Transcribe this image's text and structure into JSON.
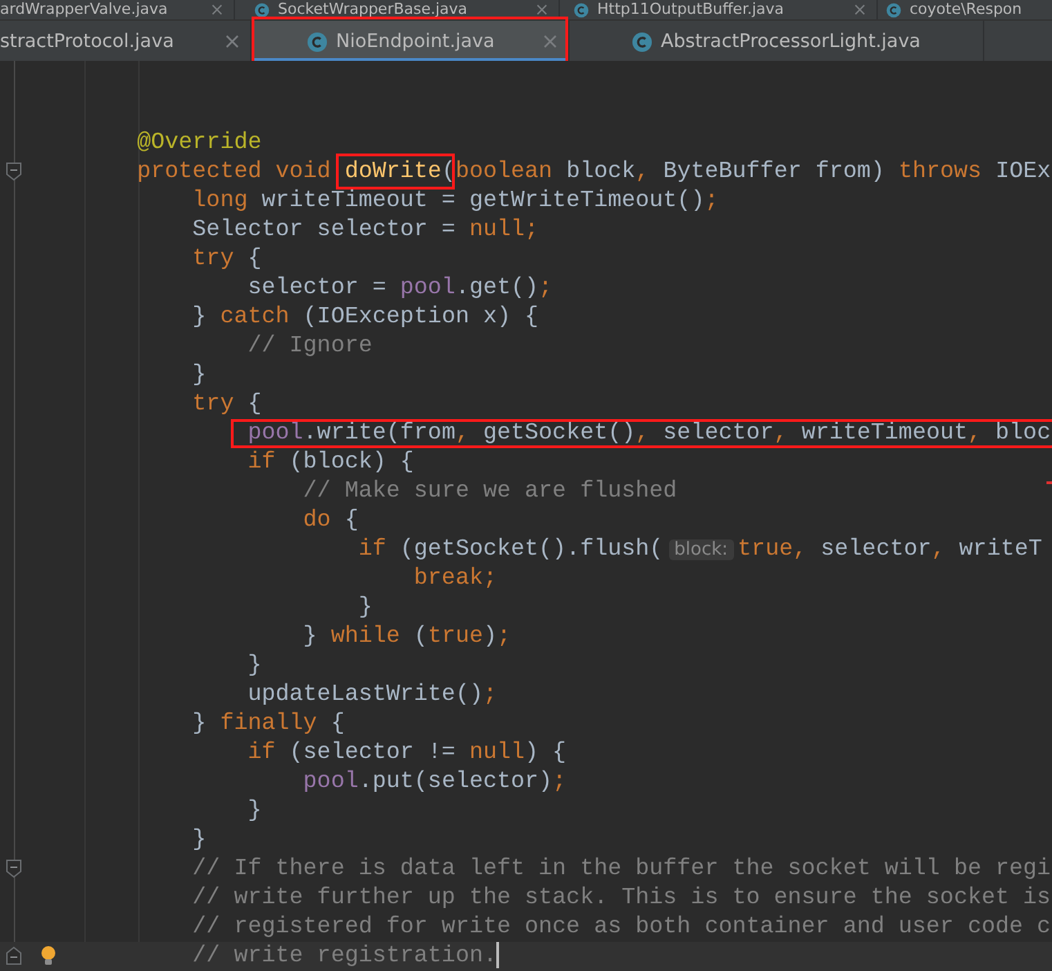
{
  "tab_rows": [
    {
      "tabs": [
        {
          "label": "ardWrapperValve.java",
          "icon": false,
          "closable": true,
          "selected": false,
          "boxed": false
        },
        {
          "label": "SocketWrapperBase.java",
          "icon": true,
          "closable": true,
          "selected": false,
          "boxed": false
        },
        {
          "label": "Http11OutputBuffer.java",
          "icon": true,
          "closable": true,
          "selected": false,
          "boxed": false
        },
        {
          "label": "coyote\\Respon",
          "icon": true,
          "closable": false,
          "selected": false,
          "boxed": false
        }
      ]
    },
    {
      "tabs": [
        {
          "label": "stractProtocol.java",
          "icon": false,
          "closable": true,
          "selected": false,
          "boxed": false
        },
        {
          "label": "NioEndpoint.java",
          "icon": true,
          "closable": true,
          "selected": true,
          "boxed": true
        },
        {
          "label": "AbstractProcessorLight.java",
          "icon": true,
          "closable": false,
          "selected": false,
          "boxed": false
        }
      ]
    }
  ],
  "editor": {
    "lines": [
      {
        "tokens": [
          {
            "kind": "annotation",
            "text": "        @Override"
          }
        ]
      },
      {
        "fold_start": true,
        "tokens": [
          {
            "kind": "keyword",
            "text": "        protected void "
          },
          {
            "kind": "declaration",
            "text": "doWrite",
            "boxed": true
          },
          {
            "kind": "plain",
            "text": "("
          },
          {
            "kind": "keyword",
            "text": "boolean "
          },
          {
            "kind": "plain",
            "text": "block"
          },
          {
            "kind": "punct",
            "text": ", "
          },
          {
            "kind": "plain",
            "text": "ByteBuffer from) "
          },
          {
            "kind": "keyword",
            "text": "throws "
          },
          {
            "kind": "plain",
            "text": "IOEx"
          }
        ]
      },
      {
        "tokens": [
          {
            "kind": "keyword",
            "text": "            long "
          },
          {
            "kind": "plain",
            "text": "writeTimeout = getWriteTimeout()"
          },
          {
            "kind": "punct",
            "text": ";"
          }
        ]
      },
      {
        "tokens": [
          {
            "kind": "plain",
            "text": "            Selector selector = "
          },
          {
            "kind": "keyword",
            "text": "null"
          },
          {
            "kind": "punct",
            "text": ";"
          }
        ]
      },
      {
        "tokens": [
          {
            "kind": "keyword",
            "text": "            try "
          },
          {
            "kind": "plain",
            "text": "{"
          }
        ]
      },
      {
        "tokens": [
          {
            "kind": "plain",
            "text": "                selector = "
          },
          {
            "kind": "field",
            "text": "pool"
          },
          {
            "kind": "plain",
            "text": ".get()"
          },
          {
            "kind": "punct",
            "text": ";"
          }
        ]
      },
      {
        "tokens": [
          {
            "kind": "plain",
            "text": "            } "
          },
          {
            "kind": "keyword",
            "text": "catch "
          },
          {
            "kind": "plain",
            "text": "(IOException x) {"
          }
        ]
      },
      {
        "tokens": [
          {
            "kind": "comment",
            "text": "                // Ignore"
          }
        ]
      },
      {
        "tokens": [
          {
            "kind": "plain",
            "text": "            }"
          }
        ]
      },
      {
        "tokens": [
          {
            "kind": "keyword",
            "text": "            try "
          },
          {
            "kind": "plain",
            "text": "{"
          }
        ]
      },
      {
        "boxed": true,
        "tokens": [
          {
            "kind": "field",
            "text": "                pool"
          },
          {
            "kind": "plain",
            "text": ".write(from"
          },
          {
            "kind": "punct",
            "text": ", "
          },
          {
            "kind": "plain",
            "text": "getSocket()"
          },
          {
            "kind": "punct",
            "text": ", "
          },
          {
            "kind": "plain",
            "text": "selector"
          },
          {
            "kind": "punct",
            "text": ", "
          },
          {
            "kind": "plain",
            "text": "writeTimeout"
          },
          {
            "kind": "punct",
            "text": ", "
          },
          {
            "kind": "plain",
            "text": "bloc"
          }
        ]
      },
      {
        "tokens": [
          {
            "kind": "keyword",
            "text": "                if "
          },
          {
            "kind": "plain",
            "text": "(block) {"
          }
        ]
      },
      {
        "tokens": [
          {
            "kind": "comment",
            "text": "                    // Make sure we are flushed"
          }
        ]
      },
      {
        "tokens": [
          {
            "kind": "keyword",
            "text": "                    do "
          },
          {
            "kind": "plain",
            "text": "{"
          }
        ]
      },
      {
        "tokens": [
          {
            "kind": "keyword",
            "text": "                        if "
          },
          {
            "kind": "plain",
            "text": "(getSocket().flush("
          },
          {
            "kind": "hint",
            "text": "block:"
          },
          {
            "kind": "keyword",
            "text": "true"
          },
          {
            "kind": "punct",
            "text": ", "
          },
          {
            "kind": "plain",
            "text": "selector"
          },
          {
            "kind": "punct",
            "text": ", "
          },
          {
            "kind": "plain",
            "text": "writeT"
          }
        ]
      },
      {
        "tokens": [
          {
            "kind": "keyword",
            "text": "                            break"
          },
          {
            "kind": "punct",
            "text": ";"
          }
        ]
      },
      {
        "tokens": [
          {
            "kind": "plain",
            "text": "                        }"
          }
        ]
      },
      {
        "tokens": [
          {
            "kind": "plain",
            "text": "                    } "
          },
          {
            "kind": "keyword",
            "text": "while "
          },
          {
            "kind": "plain",
            "text": "("
          },
          {
            "kind": "keyword",
            "text": "true"
          },
          {
            "kind": "plain",
            "text": ")"
          },
          {
            "kind": "punct",
            "text": ";"
          }
        ]
      },
      {
        "tokens": [
          {
            "kind": "plain",
            "text": "                }"
          }
        ]
      },
      {
        "tokens": [
          {
            "kind": "plain",
            "text": "                updateLastWrite()"
          },
          {
            "kind": "punct",
            "text": ";"
          }
        ]
      },
      {
        "tokens": [
          {
            "kind": "plain",
            "text": "            } "
          },
          {
            "kind": "keyword",
            "text": "finally "
          },
          {
            "kind": "plain",
            "text": "{"
          }
        ]
      },
      {
        "tokens": [
          {
            "kind": "keyword",
            "text": "                if "
          },
          {
            "kind": "plain",
            "text": "(selector != "
          },
          {
            "kind": "keyword",
            "text": "null"
          },
          {
            "kind": "plain",
            "text": ") {"
          }
        ]
      },
      {
        "tokens": [
          {
            "kind": "field",
            "text": "                    pool"
          },
          {
            "kind": "plain",
            "text": ".put(selector)"
          },
          {
            "kind": "punct",
            "text": ";"
          }
        ]
      },
      {
        "tokens": [
          {
            "kind": "plain",
            "text": "                }"
          }
        ]
      },
      {
        "tokens": [
          {
            "kind": "plain",
            "text": "            }"
          }
        ]
      },
      {
        "fold_start": true,
        "tokens": [
          {
            "kind": "comment",
            "text": "            // If there is data left in the buffer the socket will be regi"
          }
        ]
      },
      {
        "tokens": [
          {
            "kind": "comment",
            "text": "            // write further up the stack. This is to ensure the socket is"
          }
        ]
      },
      {
        "tokens": [
          {
            "kind": "comment",
            "text": "            // registered for write once as both container and user code c"
          }
        ]
      },
      {
        "fold_end": true,
        "current": true,
        "intention": true,
        "tokens": [
          {
            "kind": "comment",
            "text": "            // write registration."
          }
        ]
      }
    ],
    "error_marks": true
  }
}
